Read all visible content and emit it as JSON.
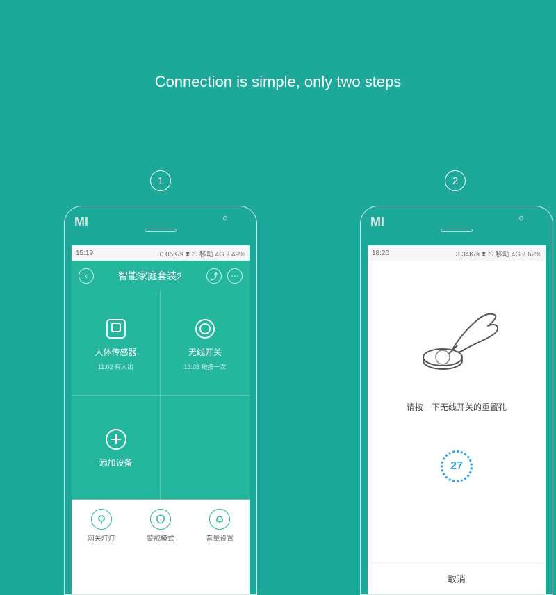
{
  "headline": "Connection is simple, only two steps",
  "steps": {
    "one": "1",
    "two": "2"
  },
  "phone_logo": "MI",
  "screen1": {
    "status": {
      "time": "15:19",
      "right": "0.05K/s ⧗ ⎋ 移动 4G ⫰ 49%"
    },
    "header": {
      "back_glyph": "‹",
      "title": "智能家庭套装2",
      "share_glyph": "⤴",
      "more_glyph": "⋯"
    },
    "tiles": [
      {
        "label": "人体传感器",
        "sub": "11:02 有人出"
      },
      {
        "label": "无线开关",
        "sub": "13:03 短按一次"
      },
      {
        "label": "添加设备",
        "sub": ""
      }
    ],
    "bottom": [
      {
        "label": "网关灯灯"
      },
      {
        "label": "警戒模式"
      },
      {
        "label": "音量设置"
      }
    ]
  },
  "screen2": {
    "status": {
      "time": "18:20",
      "right": "3.34K/s ⧗ ⎋ 移动 4G ⫰ 62%"
    },
    "instruction": "请按一下无线开关的重置孔",
    "countdown": "27",
    "cancel": "取消"
  },
  "colors": {
    "bg": "#1da99a",
    "accent": "#24b79d",
    "blue": "#2aa6f2"
  }
}
